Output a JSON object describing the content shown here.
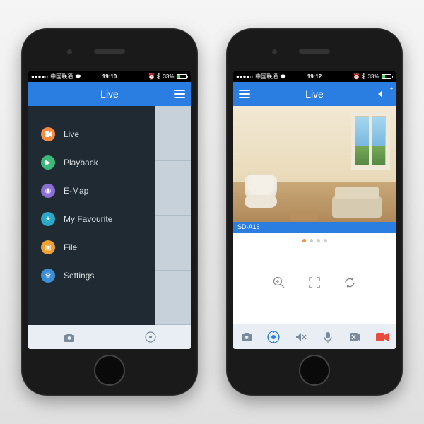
{
  "statusbar": {
    "carrier": "中国联通",
    "time_left": "19:10",
    "time_right": "19:12",
    "battery": "33%"
  },
  "header": {
    "title": "Live"
  },
  "drawer": {
    "items": [
      {
        "label": "Live",
        "icon": "camera"
      },
      {
        "label": "Playback",
        "icon": "play"
      },
      {
        "label": "E-Map",
        "icon": "pin"
      },
      {
        "label": "My Favourite",
        "icon": "star"
      },
      {
        "label": "File",
        "icon": "folder"
      },
      {
        "label": "Settings",
        "icon": "gear"
      }
    ]
  },
  "video": {
    "camera_label": "SD-A16"
  },
  "pager": {
    "count": 4,
    "active": 0
  }
}
